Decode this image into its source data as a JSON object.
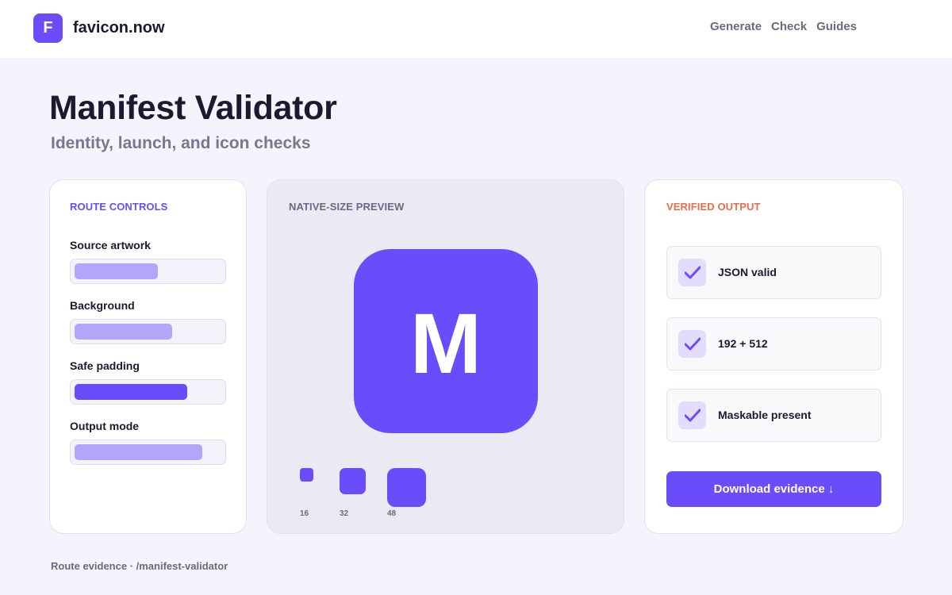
{
  "header": {
    "logo_letter": "F",
    "brand": "favicon.now",
    "nav": [
      "Generate",
      "Check",
      "Guides"
    ]
  },
  "page": {
    "title": "Manifest Validator",
    "subtitle": "Identity, launch, and icon checks"
  },
  "controls": {
    "heading": "ROUTE CONTROLS",
    "items": [
      {
        "label": "Source artwork",
        "level": 0.56
      },
      {
        "label": "Background",
        "level": 0.66
      },
      {
        "label": "Safe padding",
        "level": 0.76
      },
      {
        "label": "Output mode",
        "level": 0.86
      }
    ]
  },
  "preview": {
    "heading": "NATIVE-SIZE PREVIEW",
    "icon_letter": "M",
    "sizes": [
      "16",
      "32",
      "48"
    ]
  },
  "output": {
    "heading": "VERIFIED OUTPUT",
    "checks": [
      "JSON valid",
      "192 + 512",
      "Maskable present"
    ],
    "download_label": "Download evidence ↓"
  },
  "footer": "Route evidence · /manifest-validator",
  "colors": {
    "accent": "#6a4cfa",
    "accent_light": "#b2a6fb",
    "output_heading": "#f06a4a",
    "background": "#f5f3fc"
  },
  "icons": [
    "logo-icon",
    "check-icon"
  ]
}
